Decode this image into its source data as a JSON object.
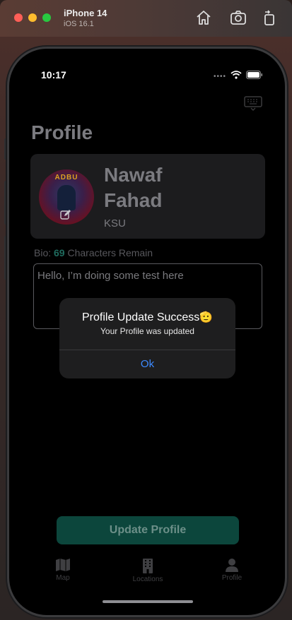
{
  "simulator": {
    "device_name": "iPhone 14",
    "os_version": "iOS 16.1",
    "toolbar_icons": [
      "home-icon",
      "screenshot-icon",
      "rotate-icon"
    ]
  },
  "status_bar": {
    "time": "10:17",
    "indicators": [
      "signal-dots",
      "wifi-icon",
      "battery-icon"
    ]
  },
  "page": {
    "title": "Profile"
  },
  "profile": {
    "first_name": "Nawaf",
    "last_name": "Fahad",
    "organization": "KSU",
    "avatar_text": "ADBU"
  },
  "bio": {
    "label_prefix": "Bio: ",
    "remaining_count": "69",
    "label_suffix": " Characters Remain",
    "text": "Hello, I’m doing some test here"
  },
  "alert": {
    "title": "Profile Update Success",
    "emoji": "🫡",
    "message": "Your Profile was updated",
    "button": "Ok"
  },
  "actions": {
    "update_button": "Update Profile"
  },
  "tabs": [
    {
      "label": "Map",
      "icon": "map-icon"
    },
    {
      "label": "Locations",
      "icon": "building-icon"
    },
    {
      "label": "Profile",
      "icon": "person-icon"
    }
  ],
  "colors": {
    "accent": "#0c463c",
    "alert_button": "#3d8aff",
    "bio_count": "#1f6b5e"
  }
}
